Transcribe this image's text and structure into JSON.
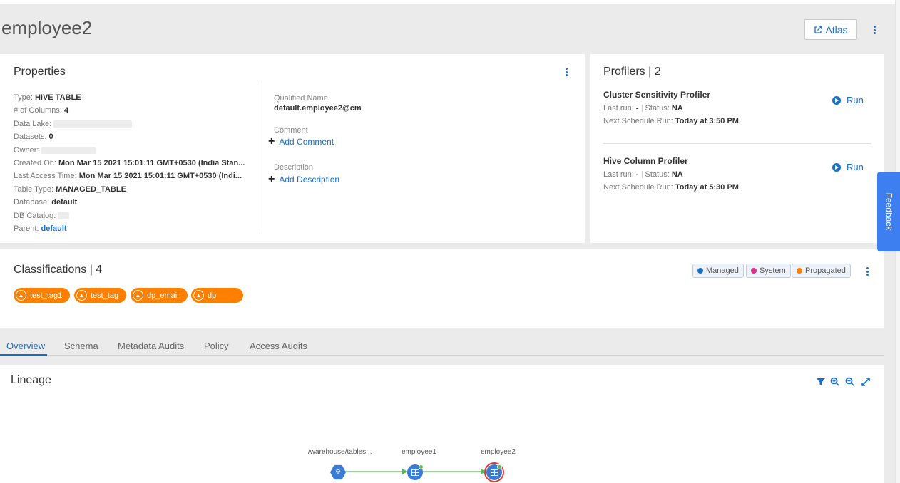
{
  "page": {
    "title": "employee2",
    "atlas_label": "Atlas"
  },
  "properties": {
    "title": "Properties",
    "type_label": "Type:",
    "type_value": "HIVE TABLE",
    "columns_label": "# of Columns:",
    "columns_value": "4",
    "datalake_label": "Data Lake:",
    "datasets_label": "Datasets:",
    "datasets_value": "0",
    "owner_label": "Owner:",
    "created_label": "Created On:",
    "created_value": "Mon Mar 15 2021 15:01:11 GMT+0530 (India Stan...",
    "access_label": "Last Access Time:",
    "access_value": "Mon Mar 15 2021 15:01:11 GMT+0530 (Indi...",
    "tabletype_label": "Table Type:",
    "tabletype_value": "MANAGED_TABLE",
    "database_label": "Database:",
    "database_value": "default",
    "dbcatalog_label": "DB Catalog:",
    "parent_label": "Parent:",
    "parent_value": "default",
    "qualified_label": "Qualified Name",
    "qualified_value": "default.employee2@cm",
    "comment_label": "Comment",
    "add_comment": "Add Comment",
    "description_label": "Description",
    "add_description": "Add Description"
  },
  "profilers": {
    "title": "Profilers | 2",
    "items": [
      {
        "name": "Cluster Sensitivity Profiler",
        "last_run_label": "Last run:",
        "last_run_value": "-",
        "status_label": "Status:",
        "status_value": "NA",
        "next_label": "Next Schedule Run:",
        "next_value": "Today at 3:50 PM",
        "run_label": "Run"
      },
      {
        "name": "Hive Column Profiler",
        "last_run_label": "Last run:",
        "last_run_value": "-",
        "status_label": "Status:",
        "status_value": "NA",
        "next_label": "Next Schedule Run:",
        "next_value": "Today at 5:30 PM",
        "run_label": "Run"
      }
    ]
  },
  "classifications": {
    "title": "Classifications | 4",
    "tags": [
      "test_tag1",
      "test_tag",
      "dp_email",
      "dp"
    ],
    "legend": [
      {
        "label": "Managed",
        "color": "#1b6fc3"
      },
      {
        "label": "System",
        "color": "#d63384"
      },
      {
        "label": "Propagated",
        "color": "#ff8000"
      }
    ]
  },
  "tabs": [
    "Overview",
    "Schema",
    "Metadata Audits",
    "Policy",
    "Access Audits"
  ],
  "lineage": {
    "title": "Lineage",
    "nodes": [
      "/warehouse/tables...",
      "employee1",
      "employee2"
    ]
  },
  "feedback_label": "Feedback",
  "colors": {
    "accent": "#1b6fc3",
    "tag_orange": "#ff8000",
    "edge_green": "#5cb85c",
    "selected_node_ring": "#e03c31"
  },
  "icons": {
    "atlas": "external-link-icon",
    "kebab": "kebab-menu-icon",
    "run": "play-circle-icon",
    "tag": "warning-triangle-icon",
    "lineage_tools": [
      "filter-icon",
      "zoom-in-icon",
      "zoom-out-icon",
      "expand-icon"
    ]
  }
}
